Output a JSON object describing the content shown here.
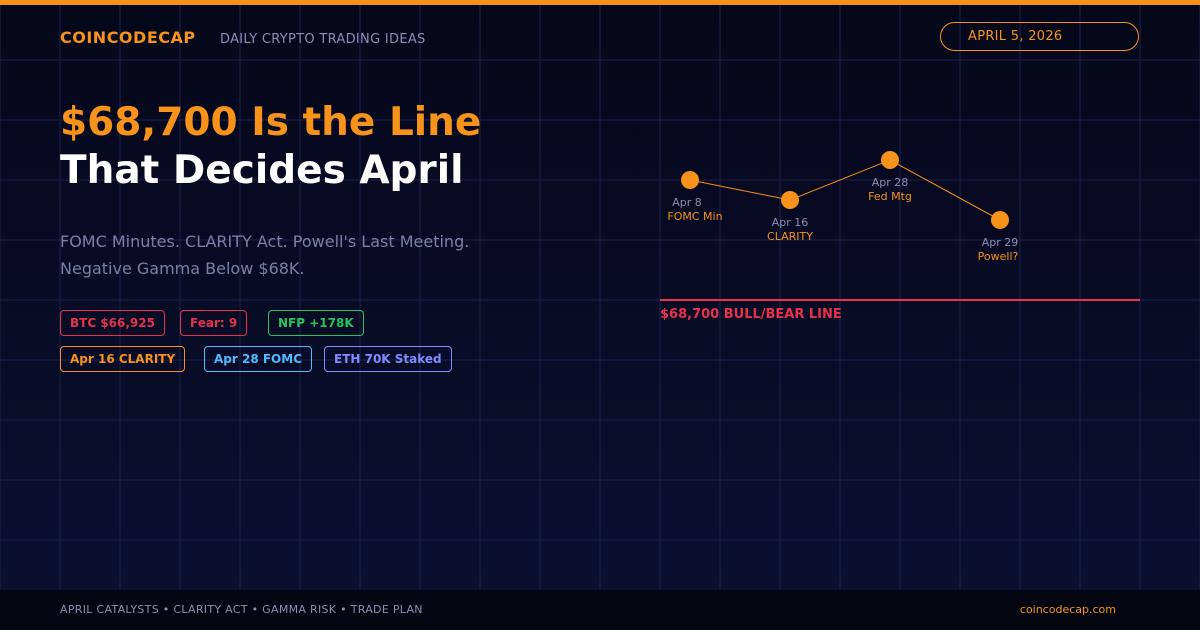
{
  "header": {
    "brand": "COINCODECAP",
    "tagline": "DAILY CRYPTO TRADING IDEAS",
    "date": "APRIL 5, 2026"
  },
  "headline": {
    "line1": "$68,700 Is the Line",
    "line2": "That Decides April",
    "subtitle": "FOMC Minutes. CLARITY Act. Powell's Last Meeting. Negative Gamma Below $68K."
  },
  "tags": [
    {
      "label": "BTC $66,925",
      "color": "#e8314d"
    },
    {
      "label": "Fear: 9",
      "color": "#e8314d"
    },
    {
      "label": "NFP +178K",
      "color": "#22c55e"
    },
    {
      "label": "Apr 16 CLARITY",
      "color": "#f7931a"
    },
    {
      "label": "Apr 28 FOMC",
      "color": "#4fb9ff"
    },
    {
      "label": "ETH 70K Staked",
      "color": "#7f8cff"
    }
  ],
  "timeline": {
    "events": [
      {
        "date": "Apr 8",
        "label": "FOMC Min"
      },
      {
        "date": "Apr 16",
        "label": "CLARITY"
      },
      {
        "date": "Apr 28",
        "label": "Fed Mtg"
      },
      {
        "date": "Apr 29",
        "label": "Powell?"
      }
    ],
    "line_label": "$68,700 BULL/BEAR LINE"
  },
  "footer": {
    "topics": "APRIL CATALYSTS  •  CLARITY ACT  •  GAMMA RISK  •  TRADE PLAN",
    "site": "coincodecap.com"
  },
  "colors": {
    "accent": "#f7931a",
    "bear": "#e8314d",
    "background": "#070a1c"
  }
}
